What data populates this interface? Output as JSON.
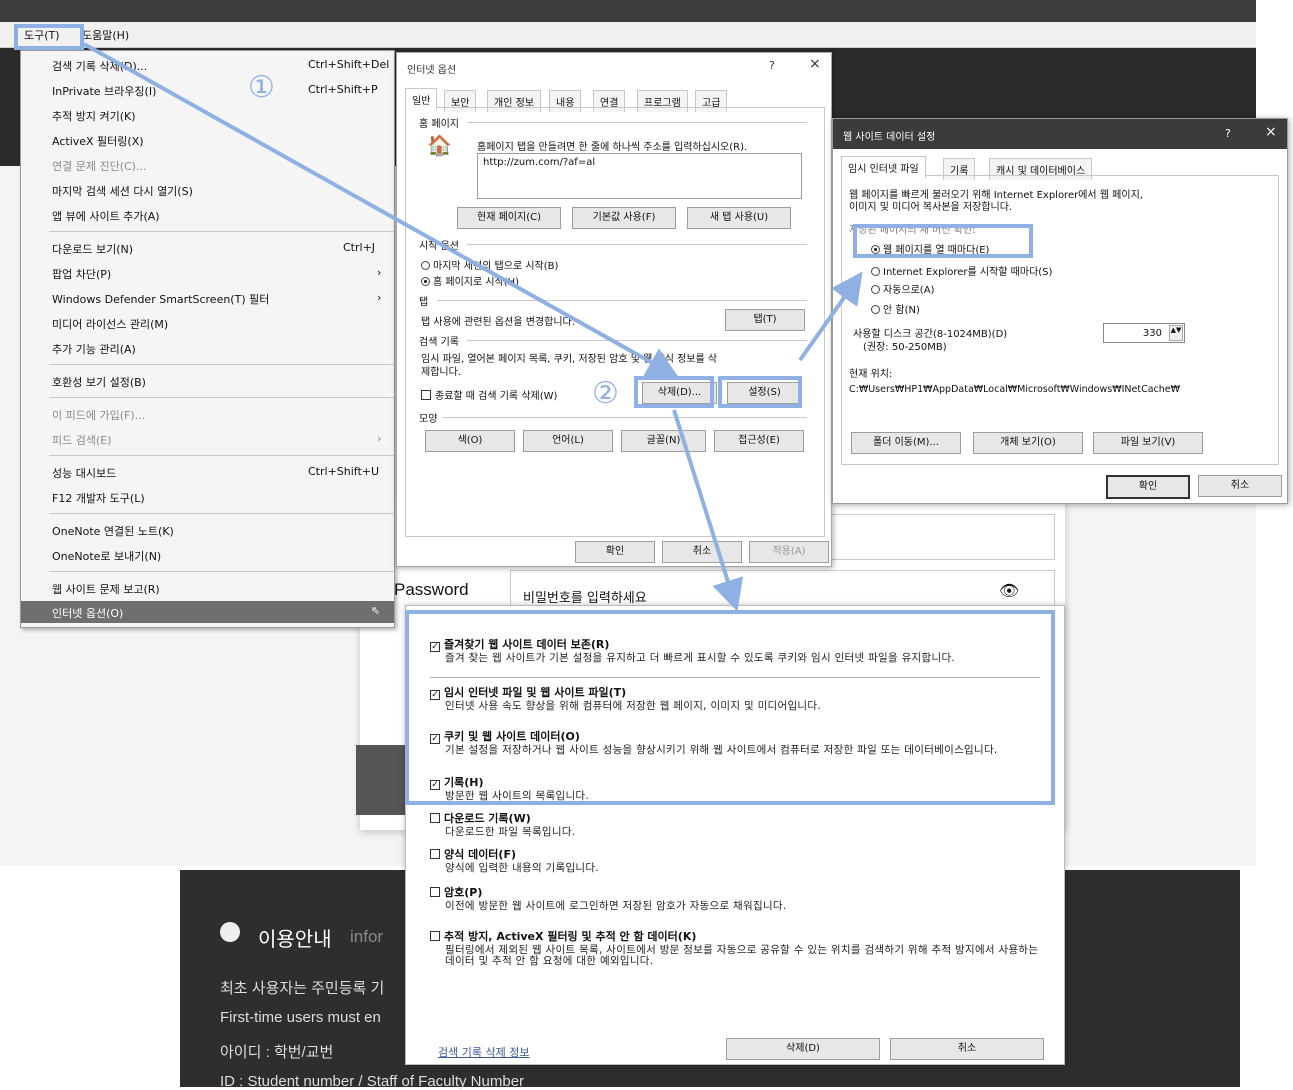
{
  "menubar": {
    "tools": "도구(T)",
    "help": "도움말(H)"
  },
  "tools_menu": {
    "items": [
      {
        "label": "검색 기록 삭제(D)...",
        "shortcut": "Ctrl+Shift+Del"
      },
      {
        "label": "InPrivate 브라우징(I)",
        "shortcut": "Ctrl+Shift+P"
      },
      {
        "label": "추적 방지 켜기(K)",
        "shortcut": ""
      },
      {
        "label": "ActiveX 필터링(X)",
        "shortcut": ""
      },
      {
        "label": "연결 문제 진단(C)...",
        "shortcut": ""
      },
      {
        "label": "마지막 검색 세션 다시 열기(S)",
        "shortcut": ""
      },
      {
        "label": "앱 뷰에 사이트 추가(A)",
        "shortcut": ""
      },
      {
        "label": "다운로드 보기(N)",
        "shortcut": "Ctrl+J"
      },
      {
        "label": "팝업 차단(P)",
        "shortcut": ""
      },
      {
        "label": "Windows Defender SmartScreen(T) 필터",
        "shortcut": ""
      },
      {
        "label": "미디어 라이선스 관리(M)",
        "shortcut": ""
      },
      {
        "label": "추가 기능 관리(A)",
        "shortcut": ""
      },
      {
        "label": "호환성 보기 설정(B)",
        "shortcut": ""
      },
      {
        "label": "이 피드에 가입(F)...",
        "shortcut": ""
      },
      {
        "label": "피드 검색(E)",
        "shortcut": ""
      },
      {
        "label": "성능 대시보드",
        "shortcut": "Ctrl+Shift+U"
      },
      {
        "label": "F12 개발자 도구(L)",
        "shortcut": ""
      },
      {
        "label": "OneNote 연결된 노트(K)",
        "shortcut": ""
      },
      {
        "label": "OneNote로 보내기(N)",
        "shortcut": ""
      },
      {
        "label": "웹 사이트 문제 보고(R)",
        "shortcut": ""
      },
      {
        "label": "인터넷 옵션(O)",
        "shortcut": ""
      }
    ]
  },
  "annotations": {
    "step1": "①",
    "step2": "②"
  },
  "internet_options": {
    "title": "인터넷 옵션",
    "help": "?",
    "close": "×",
    "tabs": [
      "일반",
      "보안",
      "개인 정보",
      "내용",
      "연결",
      "프로그램",
      "고급"
    ],
    "home_group": "홈 페이지",
    "home_desc": "홈페이지 탭을 만들려면 한 줄에 하나씩 주소를 입력하십시오(R).",
    "home_url": "http://zum.com/?af=al",
    "btn_current": "현재 페이지(C)",
    "btn_default": "기본값 사용(F)",
    "btn_newtab": "새 탭 사용(U)",
    "startup_group": "시작 옵션",
    "startup_last": "마지막 세션의 탭으로 시작(B)",
    "startup_home": "홈 페이지로 시작(H)",
    "tabs_group": "탭",
    "tabs_desc": "탭 사용에 관련된 옵션을 변경합니다.",
    "btn_tabs": "탭(T)",
    "history_group": "검색 기록",
    "history_desc1": "임시 파일, 열어본 페이지 목록, 쿠키, 저장된 암호 및 웹 양식 정보를 삭",
    "history_desc2": "제합니다.",
    "history_check": "종료할 때 검색 기록 삭제(W)",
    "btn_delete": "삭제(D)...",
    "btn_settings": "설정(S)",
    "appearance_group": "모양",
    "btn_color": "색(O)",
    "btn_lang": "언어(L)",
    "btn_font": "글꼴(N)",
    "btn_access": "접근성(E)",
    "btn_ok": "확인",
    "btn_cancel": "취소",
    "btn_apply": "적용(A)"
  },
  "website_data": {
    "title": "웹 사이트 데이터 설정",
    "help": "?",
    "close": "×",
    "tabs": [
      "임시 인터넷 파일",
      "기록",
      "캐시 및 데이터베이스"
    ],
    "desc1": "웹 페이지를 빠르게 불러오기 위해 Internet Explorer에서 웹 페이지,",
    "desc2": "이미지 및 미디어 복사본을 저장합니다.",
    "check_label": "저장된 페이지의 새 버전 확인:",
    "opt1": "웹 페이지를 열 때마다(E)",
    "opt2": "Internet Explorer를 시작할 때마다(S)",
    "opt3": "자동으로(A)",
    "opt4": "안 함(N)",
    "disk_label": "사용할 디스크 공간(8-1024MB)(D)",
    "disk_hint": "(권장: 50-250MB)",
    "disk_value": "330",
    "location_label": "현재 위치:",
    "location_path": "C:₩Users₩HP1₩AppData₩Local₩Microsoft₩Windows₩INetCache₩",
    "btn_move": "폴더 이동(M)...",
    "btn_objects": "개체 보기(O)",
    "btn_files": "파일 보기(V)",
    "btn_ok": "확인",
    "btn_cancel": "취소"
  },
  "delete_history": {
    "items": [
      {
        "title": "즐겨찾기 웹 사이트 데이터 보존(R)",
        "desc": "즐겨 찾는 웹 사이트가 기본 설정을 유지하고 더 빠르게 표시할 수 있도록 쿠키와 임시 인터넷 파일을 유지합니다.",
        "checked": true
      },
      {
        "title": "임시 인터넷 파일 및 웹 사이트 파일(T)",
        "desc": "인터넷 사용 속도 향상을 위해 컴퓨터에 저장한 웹 페이지, 이미지 및 미디어입니다.",
        "checked": true
      },
      {
        "title": "쿠키 및 웹 사이트 데이터(O)",
        "desc": "기본 설정을 저장하거나 웹 사이트 성능을 향상시키기 위해 웹 사이트에서 컴퓨터로 저장한 파일 또는 데이터베이스입니다.",
        "checked": true
      },
      {
        "title": "기록(H)",
        "desc": "방문한 웹 사이트의 목록입니다.",
        "checked": true
      },
      {
        "title": "다운로드 기록(W)",
        "desc": "다운로드한 파일 목록입니다.",
        "checked": false
      },
      {
        "title": "양식 데이터(F)",
        "desc": "양식에 입력한 내용의 기록입니다.",
        "checked": false
      },
      {
        "title": "암호(P)",
        "desc": "이전에 방문한 웹 사이트에 로그인하면 저장된 암호가 자동으로 채워집니다.",
        "checked": false
      },
      {
        "title": "추적 방지, ActiveX 필터링 및 추적 안 함 데이터(K)",
        "desc": "필터링에서 제외된 웹 사이트 목록, 사이트에서 방문 정보를 자동으로 공유할 수 있는 위치를 검색하기 위해 추적 방지에서 사용하는 데이터 및 추적 안 함 요청에 대한 예외입니다.",
        "checked": false
      }
    ],
    "info_link": "검색 기록 삭제 정보",
    "btn_delete": "삭제(D)",
    "btn_cancel": "취소"
  },
  "login": {
    "password_label": "Password",
    "password_placeholder": "비밀번호를 입력하세요",
    "eye": "👁"
  },
  "footer": {
    "title": "이용안내",
    "title_en": "infor",
    "lines": [
      "최초 사용자는 주민등록 기",
      "First-time users must en",
      "아이디 : 학번/교번",
      "ID : Student number / Staff of Faculty Number"
    ]
  }
}
